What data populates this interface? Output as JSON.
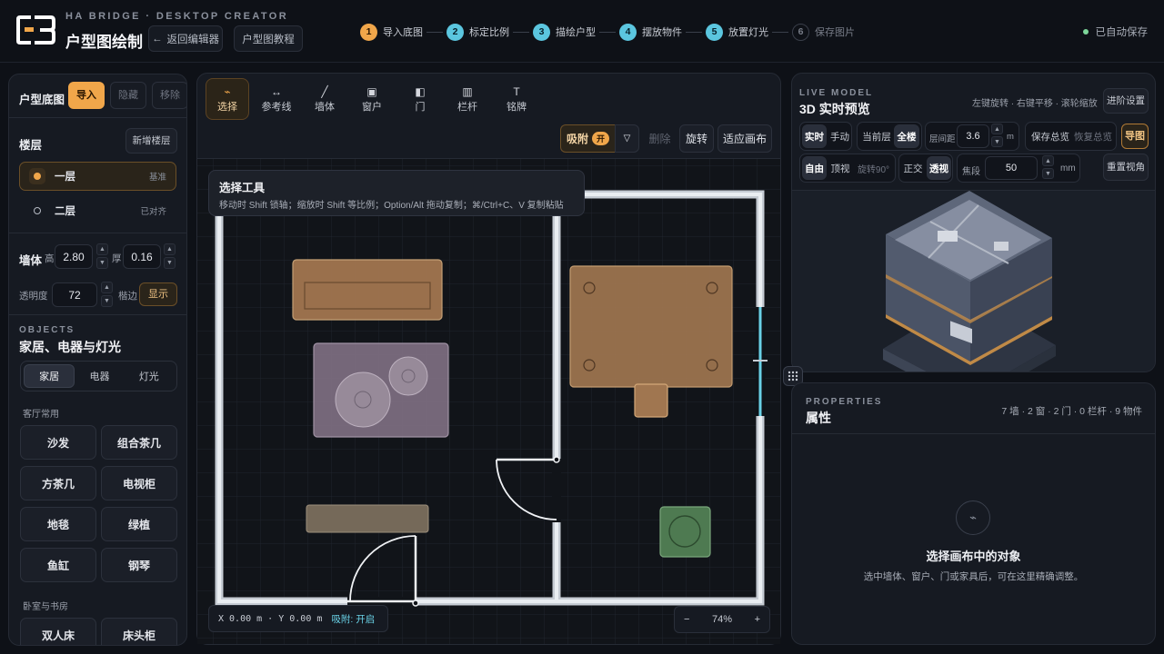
{
  "header": {
    "brand_sub": "HA BRIDGE · DESKTOP CREATOR",
    "title": "户型图绘制",
    "back_button": "返回编辑器",
    "tutorial_button": "户型图教程",
    "autosave": "已自动保存",
    "accent": "#f0a64a",
    "step_color": "#5bc6df",
    "steps": [
      {
        "num": "1",
        "label": "导入底图",
        "state": "active"
      },
      {
        "num": "2",
        "label": "标定比例",
        "state": "pending"
      },
      {
        "num": "3",
        "label": "描绘户型",
        "state": "pending"
      },
      {
        "num": "4",
        "label": "摆放物件",
        "state": "pending"
      },
      {
        "num": "5",
        "label": "放置灯光",
        "state": "pending"
      },
      {
        "num": "6",
        "label": "保存图片",
        "state": "disabled"
      }
    ]
  },
  "left": {
    "floorplan_label": "户型底图",
    "import_btn": "导入",
    "hide_btn": "隐藏",
    "remove_btn": "移除",
    "floors_label": "楼层",
    "add_floor_btn": "新增楼层",
    "floors": [
      {
        "name": "一层",
        "note": "基准",
        "selected": true
      },
      {
        "name": "二层",
        "note": "已对齐",
        "selected": false
      }
    ],
    "wall_label": "墙体",
    "height_label": "高",
    "height_value": "2.80",
    "thick_label": "厚",
    "thick_value": "0.16",
    "opacity_label": "透明度",
    "opacity_value": "72",
    "edge_label": "楷边",
    "show_btn": "显示",
    "objects_eyebrow": "OBJECTS",
    "objects_title": "家居、电器与灯光",
    "tabs": [
      "家居",
      "电器",
      "灯光"
    ],
    "living_title": "客厅常用",
    "living_items": [
      "沙发",
      "组合茶几",
      "方茶几",
      "电视柜",
      "地毯",
      "绿植",
      "鱼缸",
      "钢琴"
    ],
    "bedroom_title": "卧室与书房",
    "bedroom_items": [
      "双人床",
      "床头柜"
    ]
  },
  "toolbar": {
    "tools": [
      {
        "label": "选择",
        "icon": "select-icon",
        "glyph": "⌁"
      },
      {
        "label": "参考线",
        "icon": "guide-icon",
        "glyph": "↔"
      },
      {
        "label": "墙体",
        "icon": "wall-icon",
        "glyph": "╱"
      },
      {
        "label": "窗户",
        "icon": "window-icon",
        "glyph": "▣"
      },
      {
        "label": "门",
        "icon": "door-icon",
        "glyph": "◧"
      },
      {
        "label": "栏杆",
        "icon": "railing-icon",
        "glyph": "▥"
      },
      {
        "label": "铭牌",
        "icon": "nameplate-icon",
        "glyph": "T"
      }
    ],
    "snap_label": "吸附",
    "snap_badge": "开",
    "delete_btn": "删除",
    "rotate_btn": "旋转",
    "fit_btn": "适应画布",
    "tooltip_title": "选择工具",
    "tooltip_text": "移动时 Shift 锁轴；缩放时 Shift 等比例；Option/Alt 拖动复制；⌘/Ctrl+C、V 复制粘贴",
    "coords": "X 0.00 m · Y 0.00 m",
    "coords_snap": "吸附: 开启",
    "zoom": "74%",
    "zoom_minus": "−",
    "zoom_plus": "+"
  },
  "preview": {
    "eyebrow": "LIVE MODEL",
    "title": "3D 实时预览",
    "hint": "左键旋转 · 右键平移 · 滚轮缩放",
    "advanced_btn": "进阶设置",
    "realtime": "实时",
    "manual": "手动",
    "current_floor": "当前层",
    "all_floors": "全楼",
    "floor_gap_label": "层间距",
    "floor_gap_value": "3.6",
    "unit_m": "m",
    "save_overview": "保存总览",
    "restore_overview": "恢复总览",
    "export_btn": "导图",
    "free": "自由",
    "topview": "顶视",
    "rotate90": "旋转90°",
    "ortho": "正交",
    "persp": "透视",
    "focal_label": "焦段",
    "focal_value": "50",
    "unit_mm": "mm",
    "reset_view": "重置视角"
  },
  "properties": {
    "eyebrow": "PROPERTIES",
    "title": "属性",
    "counts": "7 墙 · 2 窗 · 2 门 · 0 栏杆 · 9 物件",
    "empty_title": "选择画布中的对象",
    "empty_text": "选中墙体、窗户、门或家具后，可在这里精确调整。"
  }
}
